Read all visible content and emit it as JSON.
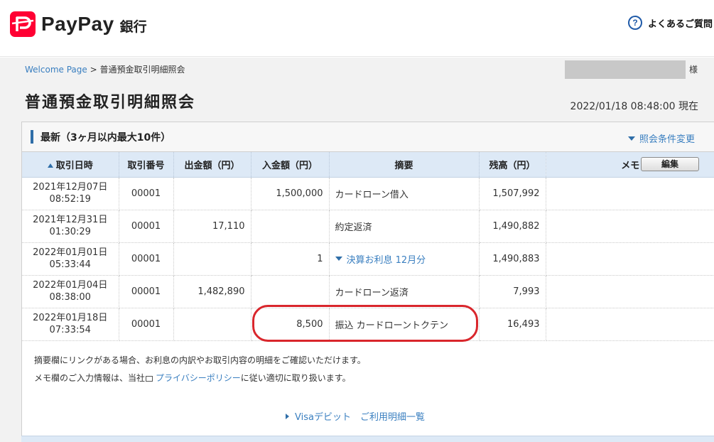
{
  "header": {
    "logo_text": "PayPay",
    "logo_sub": "銀行",
    "faq_label": "よくあるご質問"
  },
  "breadcrumb": {
    "home": "Welcome Page",
    "separator": " > ",
    "current": "普通預金取引明細照会"
  },
  "user": {
    "suffix": "様"
  },
  "page": {
    "title": "普通預金取引明細照会",
    "timestamp": "2022/01/18 08:48:00 現在"
  },
  "panel": {
    "title": "最新（3ヶ月以内最大10件）",
    "condition_link": "照会条件変更"
  },
  "table": {
    "columns": {
      "date": "取引日時",
      "number": "取引番号",
      "withdrawal": "出金額（円）",
      "deposit": "入金額（円）",
      "description": "摘要",
      "balance": "残高（円）",
      "memo": "メモ",
      "edit": "編集"
    },
    "rows": [
      {
        "date": "2021年12月07日",
        "time": "08:52:19",
        "number": "00001",
        "withdrawal": "",
        "deposit": "1,500,000",
        "description": "カードローン借入",
        "balance": "1,507,992",
        "memo": ""
      },
      {
        "date": "2021年12月31日",
        "time": "01:30:29",
        "number": "00001",
        "withdrawal": "17,110",
        "deposit": "",
        "description": "約定返済",
        "balance": "1,490,882",
        "memo": ""
      },
      {
        "date": "2022年01月01日",
        "time": "05:33:44",
        "number": "00001",
        "withdrawal": "",
        "deposit": "1",
        "description": "決算お利息 12月分",
        "balance": "1,490,883",
        "memo": ""
      },
      {
        "date": "2022年01月04日",
        "time": "08:38:00",
        "number": "00001",
        "withdrawal": "1,482,890",
        "deposit": "",
        "description": "カードローン返済",
        "balance": "7,993",
        "memo": ""
      },
      {
        "date": "2022年01月18日",
        "time": "07:33:54",
        "number": "00001",
        "withdrawal": "",
        "deposit": "8,500",
        "description": "振込 カードローントクテン",
        "balance": "16,493",
        "memo": ""
      }
    ]
  },
  "notes": {
    "line1": "摘要欄にリンクがある場合、お利息の内訳やお取引内容の明細をご確認いただけます。",
    "line2_prefix": "メモ欄のご入力情報は、当社",
    "line2_link": "プライバシーポリシー",
    "line2_suffix": "に従い適切に取り扱います。"
  },
  "footer_link": "Visaデビット　ご利用明細一覧",
  "colors": {
    "brand_red": "#ff0033",
    "link_blue": "#3a7fc0",
    "header_blue": "#dde9f6",
    "highlight_red": "#d9262c"
  }
}
